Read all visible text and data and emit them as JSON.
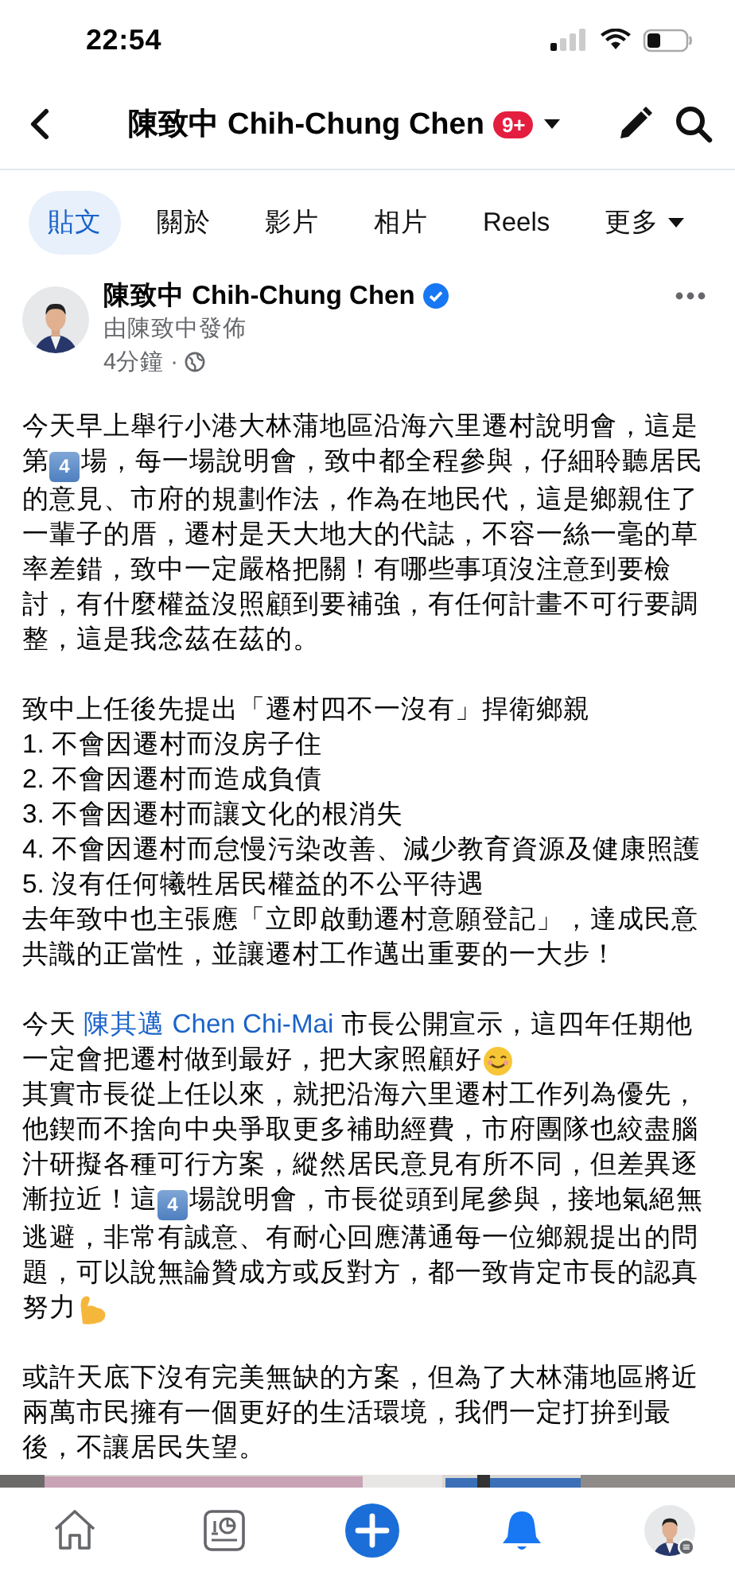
{
  "status_bar": {
    "time": "22:54"
  },
  "header": {
    "title": "陳致中 Chih-Chung Chen",
    "badge": "9+"
  },
  "tabs": [
    {
      "label": "貼文",
      "selected": true
    },
    {
      "label": "關於",
      "selected": false
    },
    {
      "label": "影片",
      "selected": false
    },
    {
      "label": "相片",
      "selected": false
    },
    {
      "label": "Reels",
      "selected": false
    },
    {
      "label": "更多",
      "selected": false,
      "kind": "menu"
    }
  ],
  "post": {
    "author": "陳致中 Chih-Chung Chen",
    "verified": true,
    "posted_by": "由陳致中發佈",
    "time": "4分鐘",
    "separator": "·",
    "blocks": [
      [
        [
          {
            "kind": "text",
            "text": "今天早上舉行小港大林蒲地區沿海六里遷村說明會，這是第"
          },
          {
            "kind": "keycap",
            "text": "4"
          },
          {
            "kind": "text",
            "text": "場，每一場說明會，致中都全程參與，仔細聆聽居民的意見、市府的規劃作法，作為在地民代，這是鄉親住了一輩子的厝，遷村是天大地大的代誌，不容一絲一毫的草率差錯，致中一定嚴格把關！有哪些事項沒注意到要檢討，有什麼權益沒照顧到要補強，有任何計畫不可行要調整，這是我念茲在茲的。"
          }
        ]
      ],
      [
        [
          {
            "kind": "text",
            "text": "致中上任後先提出「遷村四不一沒有」捍衛鄉親"
          }
        ],
        [
          {
            "kind": "text",
            "text": "1. 不會因遷村而沒房子住"
          }
        ],
        [
          {
            "kind": "text",
            "text": "2. 不會因遷村而造成負債"
          }
        ],
        [
          {
            "kind": "text",
            "text": "3. 不會因遷村而讓文化的根消失"
          }
        ],
        [
          {
            "kind": "text",
            "text": "4. 不會因遷村而怠慢污染改善、減少教育資源及健康照護"
          }
        ],
        [
          {
            "kind": "text",
            "text": "5. 沒有任何犧牲居民權益的不公平待遇"
          }
        ],
        [
          {
            "kind": "text",
            "text": "去年致中也主張應「立即啟動遷村意願登記」，達成民意共識的正當性，並讓遷村工作邁出重要的一大步！"
          }
        ]
      ],
      [
        [
          {
            "kind": "text",
            "text": "今天 "
          },
          {
            "kind": "link",
            "text": "陳其邁 Chen Chi-Mai"
          },
          {
            "kind": "text",
            "text": " 市長公開宣示，這四年任期他一定會把遷村做到最好，把大家照顧好"
          },
          {
            "kind": "smiley"
          }
        ],
        [
          {
            "kind": "text",
            "text": "其實市長從上任以來，就把沿海六里遷村工作列為優先，他鍥而不捨向中央爭取更多補助經費，市府團隊也絞盡腦汁研擬各種可行方案，縱然居民意見有所不同，但差異逐漸拉近！這"
          },
          {
            "kind": "keycap",
            "text": "4"
          },
          {
            "kind": "text",
            "text": "場說明會，市長從頭到尾參與，接地氣絕無逃避，非常有誠意、有耐心回應溝通每一位鄉親提出的問題，可以說無論贊成方或反對方，都一致肯定市長的認真努力"
          },
          {
            "kind": "flex"
          }
        ]
      ],
      [
        [
          {
            "kind": "text",
            "text": "或許天底下沒有完美無缺的方案，但為了大林蒲地區將近兩萬市民擁有一個更好的生活環境，我們一定打拚到最後，不讓居民失望。"
          }
        ]
      ]
    ]
  },
  "nav": [
    {
      "kind": "home",
      "selected": false
    },
    {
      "kind": "dashboard",
      "selected": false
    },
    {
      "kind": "create",
      "selected": false
    },
    {
      "kind": "notifications",
      "selected": true
    },
    {
      "kind": "profile",
      "selected": false
    }
  ]
}
